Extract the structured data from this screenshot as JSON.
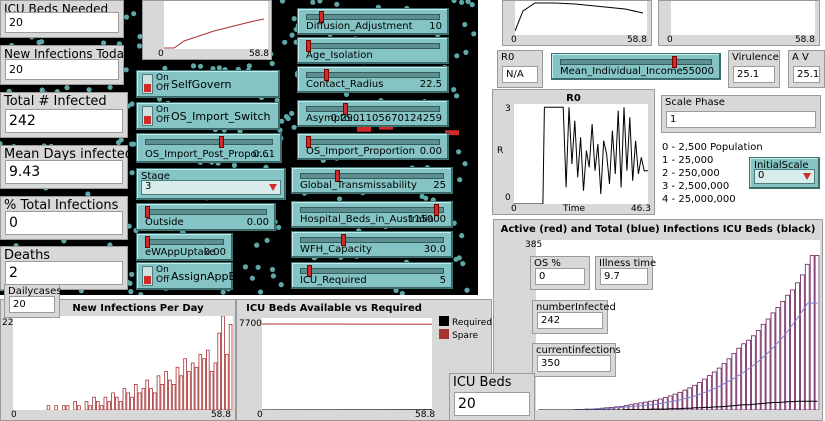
{
  "monitors": {
    "icu_beds_needed": {
      "label": "ICU Beds Needed",
      "value": "20"
    },
    "new_infections_today": {
      "label": "New Infections Today",
      "value": "20"
    },
    "total_infected": {
      "label": "Total # Infected",
      "value": "242"
    },
    "mean_days_infected": {
      "label": "Mean Days infected",
      "value": "9.43"
    },
    "pct_total_infections": {
      "label": "% Total Infections",
      "value": "0"
    },
    "deaths": {
      "label": "Deaths",
      "value": "2"
    },
    "dailycases": {
      "label": "Dailycases",
      "value": "20"
    },
    "r0": {
      "label": "R0",
      "value": "N/A"
    },
    "virulence": {
      "label": "Virulence",
      "value": "25.1"
    },
    "av": {
      "label": "A V",
      "value": "25.1"
    },
    "scale_phase": {
      "label": "Scale Phase",
      "value": "1"
    },
    "os_pct": {
      "label": "OS %",
      "value": "0"
    },
    "illness_time": {
      "label": "Illness time",
      "value": "9.7"
    },
    "number_infected": {
      "label": "numberInfected",
      "value": "242"
    },
    "current_infections": {
      "label": "currentinfections",
      "value": "350"
    },
    "icu_beds": {
      "label": "ICU Beds",
      "value": "20"
    }
  },
  "switches": {
    "selfgovern": {
      "label": "SelfGovern",
      "on": "On",
      "off": "Off"
    },
    "os_import_switch": {
      "label": "OS_Import_Switch",
      "on": "On",
      "off": "Off"
    },
    "assignappess": {
      "label": "AssignAppEss",
      "on": "On",
      "off": "Off"
    }
  },
  "sliders": {
    "os_import_post_proportion": {
      "label": "OS_Import_Post_Propor...",
      "value": "0.61",
      "level": 0.61
    },
    "outside": {
      "label": "Outside",
      "value": "0.00",
      "level": 0.0
    },
    "ewappuptake": {
      "label": "eWAppUptake",
      "value": "0.00",
      "level": 0.0
    },
    "diffusion_adjustment": {
      "label": "Diffusion_Adjustment",
      "value": "10",
      "level": 0.1
    },
    "age_isolation": {
      "label": "Age_Isolation",
      "value": "",
      "level": 0.0
    },
    "contact_radius": {
      "label": "Contact_Radius",
      "value": "22.5",
      "level": 0.14
    },
    "asymptomatic": {
      "label": "Asympto...",
      "value": "0.290110567012425​9",
      "level": 0.29
    },
    "os_import_proportion": {
      "label": "OS_Import_Proportion",
      "value": "0.00",
      "level": 0.0
    },
    "global_transmissability": {
      "label": "Global_Transmissability",
      "value": "25",
      "level": 0.25
    },
    "hospital_beds": {
      "label": "Hospital_Beds_in_Australia",
      "value": "115000",
      "level": 0.97
    },
    "wfh_capacity": {
      "label": "WFH_Capacity",
      "value": "30.0",
      "level": 0.3
    },
    "icu_required": {
      "label": "ICU_Required",
      "value": "5",
      "level": 0.05
    },
    "mean_individual_income": {
      "label": "Mean_Individual_Income",
      "value": "55000",
      "level": 0.77
    }
  },
  "choosers": {
    "stage": {
      "label": "Stage",
      "value": "3"
    },
    "initialscale": {
      "label": "InitialScale",
      "value": "0"
    }
  },
  "scale_notes": [
    "0 - 2,500 Population",
    "1 - 25,000",
    "2 - 250,000",
    "3 - 2,500,000",
    "4 - 25,000,000"
  ],
  "plots": {
    "top_small": {
      "xmin": "0",
      "xmax": "58.8"
    },
    "top_right_a": {
      "xmin": "0",
      "xmax": "58.8"
    },
    "top_right_b": {
      "xmin": "0",
      "xmax": "58.8"
    },
    "r0_plot": {
      "title": "R0",
      "ylabel": "R",
      "xlabel": "Time",
      "xmin": "0",
      "xmax": "46.3",
      "ymin": "0",
      "ymax": "3"
    },
    "new_infections": {
      "title": "New Infections Per Day",
      "ymin": "0",
      "ymax": "22",
      "xmin": "0",
      "xmax": "58.8"
    },
    "icu_beds": {
      "title": "ICU Beds Available vs Required",
      "ymin": "0",
      "ymax": "7700",
      "xmin": "0",
      "xmax": "58.8",
      "legend": [
        "Required",
        "Spare"
      ]
    },
    "infections": {
      "title": "Active (red) and Total (blue) Infections ICU Beds (black)",
      "ymin": "0",
      "ymax": "385",
      "xmin": "0",
      "xmax": "58.8"
    }
  },
  "colors": {
    "widget": "#84c4c4",
    "thumb": "#d02a2a",
    "plot_red": "#a83232",
    "plot_purple": "#6a1c5a",
    "plot_blue": "#8080cc"
  },
  "chart_data": [
    {
      "type": "bar",
      "title": "New Infections Per Day",
      "xlabel": "",
      "ylabel": "",
      "xlim": [
        0,
        58.8
      ],
      "ylim": [
        0,
        22
      ],
      "values": [
        0,
        0,
        0,
        0,
        0,
        0,
        0,
        0,
        0,
        1,
        0,
        1,
        0,
        1,
        1,
        0,
        2,
        1,
        0,
        2,
        1,
        3,
        2,
        1,
        3,
        2,
        4,
        3,
        2,
        5,
        4,
        3,
        6,
        4,
        5,
        7,
        5,
        4,
        8,
        6,
        9,
        7,
        6,
        10,
        8,
        12,
        9,
        11,
        10,
        13,
        12,
        14,
        9,
        11,
        18,
        22,
        13,
        20
      ]
    },
    {
      "type": "line",
      "title": "R0",
      "xlabel": "Time",
      "ylabel": "R",
      "xlim": [
        0,
        46.3
      ],
      "ylim": [
        0,
        3
      ],
      "x": [
        0,
        10,
        10.5,
        13,
        15,
        17,
        18,
        19,
        20,
        21,
        22,
        23,
        24,
        25,
        26,
        27,
        28,
        29,
        30,
        31,
        32,
        33,
        34,
        35,
        36,
        37,
        38,
        39,
        40,
        41,
        42,
        43,
        44,
        45,
        46.3
      ],
      "y": [
        0,
        0,
        2.9,
        2.9,
        2.9,
        2.9,
        0.5,
        2.9,
        1.2,
        2.5,
        0.8,
        2.0,
        0.4,
        1.6,
        1.1,
        2.4,
        1.0,
        1.8,
        0.3,
        1.9,
        1.5,
        0.6,
        2.2,
        0.9,
        2.8,
        0.5,
        2.9,
        1.0,
        2.6,
        0.7,
        1.9,
        0.9,
        1.4,
        1.0,
        1.0
      ]
    },
    {
      "type": "line",
      "title": "ICU Beds Available vs Required",
      "xlim": [
        0,
        58.8
      ],
      "ylim": [
        0,
        7700
      ],
      "series": [
        {
          "name": "Required",
          "x": [
            0,
            58.8
          ],
          "y": [
            0,
            20
          ]
        },
        {
          "name": "Spare",
          "x": [
            0,
            58.8
          ],
          "y": [
            7700,
            7680
          ]
        }
      ]
    },
    {
      "type": "bar",
      "title": "Active (red) and Total (blue) Infections ICU Beds (black)",
      "xlim": [
        0,
        58.8
      ],
      "ylim": [
        0,
        385
      ],
      "values": [
        0,
        0,
        0,
        0,
        0,
        0,
        0,
        0,
        1,
        1,
        2,
        2,
        3,
        4,
        5,
        6,
        7,
        8,
        10,
        12,
        14,
        16,
        18,
        20,
        22,
        25,
        28,
        32,
        36,
        40,
        45,
        50,
        56,
        62,
        70,
        78,
        86,
        95,
        105,
        116,
        128,
        140,
        150,
        158,
        168,
        180,
        194,
        206,
        220,
        232,
        246,
        260,
        272,
        288,
        306,
        330,
        350,
        350
      ],
      "series": [
        {
          "name": "Total",
          "values": [
            0,
            0,
            0,
            0,
            0,
            0,
            0,
            0,
            1,
            1,
            1,
            2,
            2,
            3,
            3,
            4,
            5,
            6,
            7,
            8,
            9,
            10,
            11,
            12,
            13,
            15,
            17,
            19,
            21,
            23,
            26,
            29,
            32,
            36,
            40,
            44,
            49,
            54,
            60,
            66,
            72,
            79,
            86,
            94,
            102,
            111,
            121,
            131,
            142,
            154,
            166,
            180,
            195,
            210,
            226,
            242,
            242,
            242
          ]
        },
        {
          "name": "ICU",
          "values": [
            0,
            0,
            0,
            0,
            0,
            0,
            0,
            0,
            0,
            0,
            0,
            0,
            0,
            0,
            0,
            0,
            0,
            0,
            1,
            1,
            1,
            1,
            1,
            2,
            2,
            2,
            2,
            3,
            3,
            3,
            4,
            4,
            5,
            5,
            6,
            6,
            7,
            7,
            8,
            9,
            10,
            11,
            12,
            12,
            13,
            14,
            15,
            16,
            17,
            17,
            18,
            19,
            19,
            20,
            20,
            20,
            20,
            20
          ]
        }
      ]
    }
  ]
}
